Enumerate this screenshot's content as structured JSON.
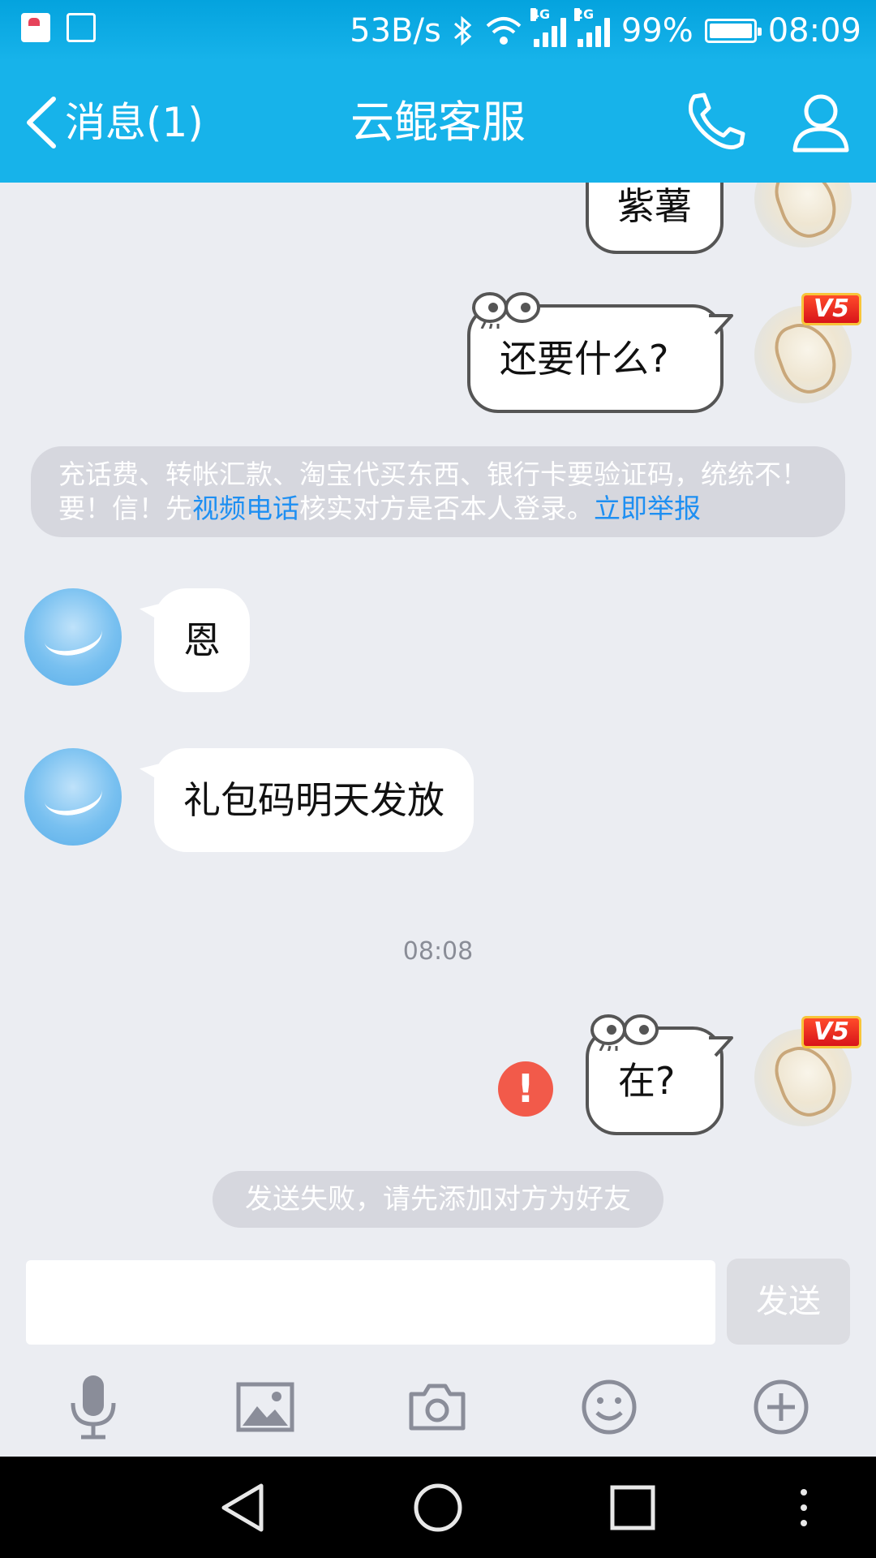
{
  "status_bar": {
    "speed": "53B/s",
    "battery": "99%",
    "time": "08:09",
    "net1": "4G",
    "net2": "2G"
  },
  "header": {
    "back_label": "消息(1)",
    "title": "云鲲客服"
  },
  "messages": {
    "m1": "紫薯",
    "m2": "还要什么?",
    "m3": "恩",
    "m4": "礼包码明天发放",
    "m5": "在?"
  },
  "warning": {
    "part1": "充话费、转帐汇款、淘宝代买东西、银行卡要验证码，统统不！要！信！先",
    "link1": "视频电话",
    "part2": "核实对方是否本人登录。",
    "link2": "立即举报"
  },
  "timestamp": "08:08",
  "vip_badge": "V5",
  "error_mark": "!",
  "send_failed": "发送失败，请先添加对方为好友",
  "composer": {
    "placeholder": "",
    "send_label": "发送"
  },
  "toolbar_icons": [
    "microphone-icon",
    "image-icon",
    "camera-icon",
    "emoji-icon",
    "plus-icon"
  ],
  "colors": {
    "accent": "#17b3ea",
    "link": "#1e8ff2",
    "error": "#f25a4a",
    "background": "#ebedf2"
  }
}
